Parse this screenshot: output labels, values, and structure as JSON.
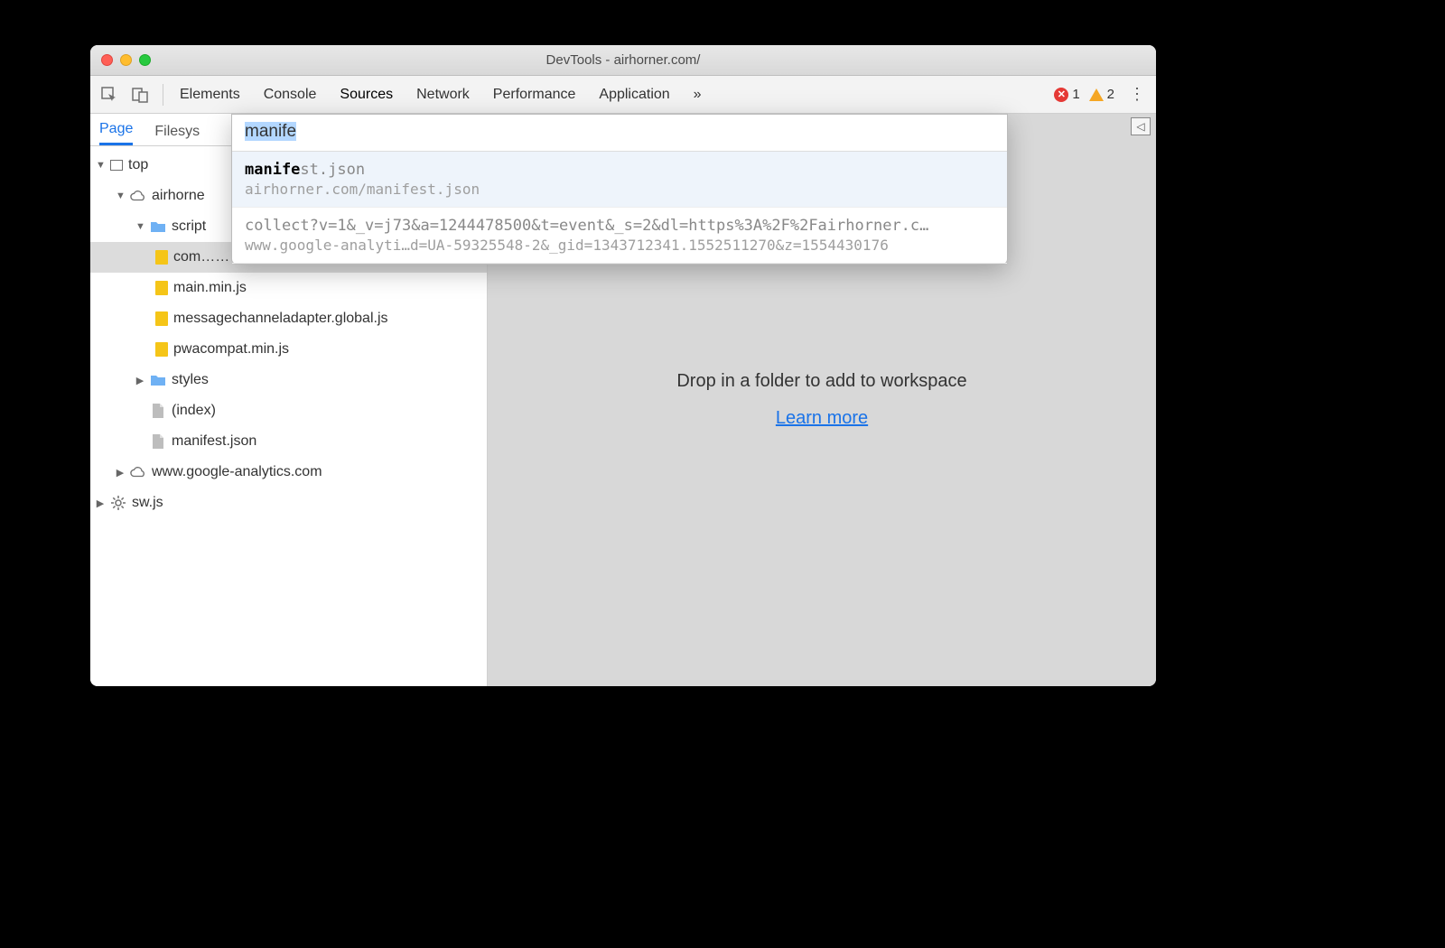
{
  "window": {
    "title": "DevTools - airhorner.com/"
  },
  "toolbar": {
    "tabs": [
      "Elements",
      "Console",
      "Sources",
      "Network",
      "Performance",
      "Application"
    ],
    "active_tab": "Sources",
    "overflow_glyph": "»",
    "errors": 1,
    "warnings": 2
  },
  "sidebar": {
    "tabs": [
      "Page",
      "Filesys"
    ],
    "active_tab": "Page",
    "tree": {
      "top": "top",
      "domain1": "airhorne",
      "scripts_folder": "script",
      "selected_js": "com…………global.js",
      "js_files": [
        "main.min.js",
        "messagechanneladapter.global.js",
        "pwacompat.min.js"
      ],
      "styles_folder": "styles",
      "index_file": "(index)",
      "manifest_file": "manifest.json",
      "domain2": "www.google-analytics.com",
      "sw_file": "sw.js"
    }
  },
  "content": {
    "drop_message": "Drop in a folder to add to workspace",
    "learn_more": "Learn more"
  },
  "file_open": {
    "query": "manife",
    "results": [
      {
        "filename_match": "manife",
        "filename_rest": "st.json",
        "path": "airhorner.com/manifest.json",
        "selected": true
      },
      {
        "filename_match": "",
        "filename_rest": "collect?v=1&_v=j73&a=1244478500&t=event&_s=2&dl=https%3A%2F%2Fairhorner.c…",
        "path": "www.google-analyti…d=UA-59325548-2&_gid=1343712341.1552511270&z=1554430176",
        "selected": false
      }
    ]
  }
}
